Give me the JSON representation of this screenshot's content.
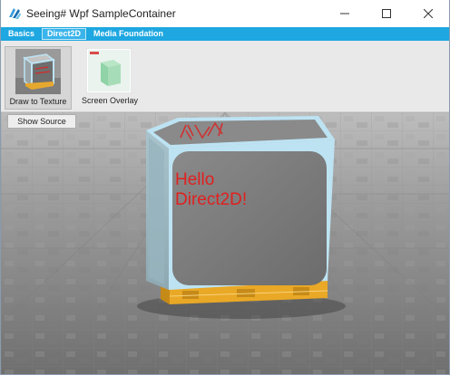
{
  "window": {
    "title": "Seeing# Wpf SampleContainer",
    "app_icon": "seeing-logo-icon",
    "controls": [
      "minimize-icon",
      "maximize-icon",
      "close-icon"
    ]
  },
  "tabs": [
    {
      "label": "Basics",
      "active": false
    },
    {
      "label": "Direct2D",
      "active": true
    },
    {
      "label": "Media Foundation",
      "active": false
    }
  ],
  "gallery": [
    {
      "label": "Draw to Texture",
      "selected": true,
      "icon": "textured-cube-thumbnail"
    },
    {
      "label": "Screen Overlay",
      "selected": false,
      "icon": "screen-overlay-thumbnail"
    }
  ],
  "toolbar": {
    "show_source_label": "Show Source"
  },
  "scene": {
    "cube_text_line1": "Hello",
    "cube_text_line2": "Direct2D!",
    "text_color": "#e02020",
    "cube_border_color": "#bde3f3",
    "cube_face_color": "#7a7a7a",
    "pallet_color": "#f2b531",
    "floor_color": "#8e8e8e"
  },
  "colors": {
    "accent": "#1ea7e1",
    "ribbon_background": "#e9e9e9"
  }
}
